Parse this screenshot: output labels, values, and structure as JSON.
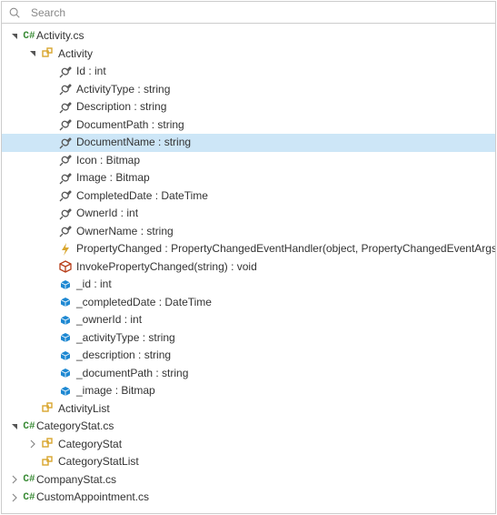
{
  "search": {
    "placeholder": "Search"
  },
  "icons": {
    "csharp_color": "#388a34",
    "class_color": "#d9a62e",
    "prop_color": "#555",
    "event_color": "#d9a62e",
    "method_color": "#b73d18",
    "field_color": "#1e88d2"
  },
  "tree": [
    {
      "kind": "file",
      "label": "Activity.cs",
      "depth": 0,
      "expander": "open"
    },
    {
      "kind": "class",
      "label": "Activity",
      "depth": 1,
      "expander": "open"
    },
    {
      "kind": "prop",
      "label": "Id : int",
      "depth": 2
    },
    {
      "kind": "prop",
      "label": "ActivityType : string",
      "depth": 2
    },
    {
      "kind": "prop",
      "label": "Description : string",
      "depth": 2
    },
    {
      "kind": "prop",
      "label": "DocumentPath : string",
      "depth": 2
    },
    {
      "kind": "prop",
      "label": "DocumentName : string",
      "depth": 2,
      "selected": true
    },
    {
      "kind": "prop",
      "label": "Icon : Bitmap",
      "depth": 2
    },
    {
      "kind": "prop",
      "label": "Image : Bitmap",
      "depth": 2
    },
    {
      "kind": "prop",
      "label": "CompletedDate : DateTime",
      "depth": 2
    },
    {
      "kind": "prop",
      "label": "OwnerId : int",
      "depth": 2
    },
    {
      "kind": "prop",
      "label": "OwnerName : string",
      "depth": 2
    },
    {
      "kind": "event",
      "label": "PropertyChanged : PropertyChangedEventHandler(object, PropertyChangedEventArgs)",
      "depth": 2
    },
    {
      "kind": "method",
      "label": "InvokePropertyChanged(string) : void",
      "depth": 2
    },
    {
      "kind": "field",
      "label": "_id : int",
      "depth": 2
    },
    {
      "kind": "field",
      "label": "_completedDate : DateTime",
      "depth": 2
    },
    {
      "kind": "field",
      "label": "_ownerId : int",
      "depth": 2
    },
    {
      "kind": "field",
      "label": "_activityType : string",
      "depth": 2
    },
    {
      "kind": "field",
      "label": "_description : string",
      "depth": 2
    },
    {
      "kind": "field",
      "label": "_documentPath : string",
      "depth": 2
    },
    {
      "kind": "field",
      "label": "_image : Bitmap",
      "depth": 2
    },
    {
      "kind": "class",
      "label": "ActivityList",
      "depth": 1,
      "expander": "none"
    },
    {
      "kind": "file",
      "label": "CategoryStat.cs",
      "depth": 0,
      "expander": "open"
    },
    {
      "kind": "class",
      "label": "CategoryStat",
      "depth": 1,
      "expander": "closed"
    },
    {
      "kind": "class",
      "label": "CategoryStatList",
      "depth": 1,
      "expander": "none"
    },
    {
      "kind": "file",
      "label": "CompanyStat.cs",
      "depth": 0,
      "expander": "closed"
    },
    {
      "kind": "file",
      "label": "CustomAppointment.cs",
      "depth": 0,
      "expander": "closed"
    }
  ]
}
